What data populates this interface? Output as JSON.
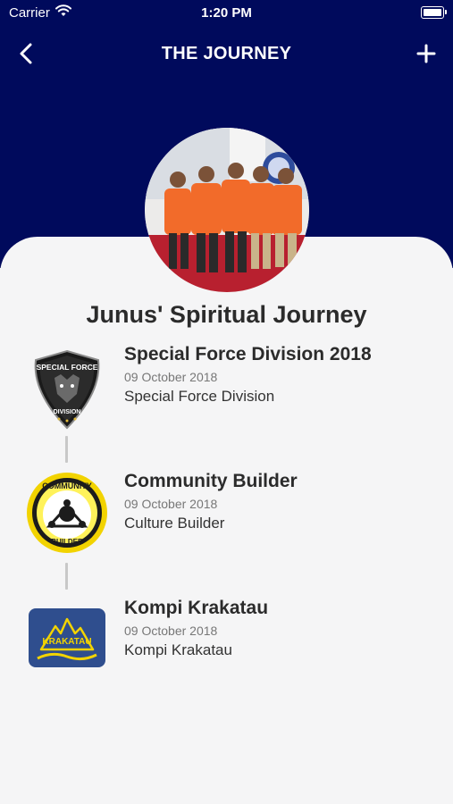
{
  "status_bar": {
    "carrier": "Carrier",
    "time": "1:20 PM"
  },
  "nav": {
    "title": "THE JOURNEY"
  },
  "profile": {
    "journey_title": "Junus' Spiritual Journey"
  },
  "entries": [
    {
      "name": "Special Force Division 2018",
      "date": "09 October 2018",
      "group": "Special Force Division",
      "badge_icon": "special-force-badge"
    },
    {
      "name": "Community Builder",
      "date": "09 October 2018",
      "group": "Culture Builder",
      "badge_icon": "community-builder-badge"
    },
    {
      "name": "Kompi Krakatau",
      "date": "09 October 2018",
      "group": "Kompi Krakatau",
      "badge_icon": "krakatau-badge"
    }
  ],
  "badges": {
    "special_force": {
      "top": "SPECIAL FORCE",
      "bottom": "DIVISION"
    },
    "community": {
      "top": "COMMUNITY",
      "bottom": "BUILDER"
    },
    "krakatau": {
      "label": "KRAKATAU"
    }
  },
  "colors": {
    "header": "#000a5c",
    "background": "#f5f5f6",
    "accent_orange": "#f26b2a"
  }
}
